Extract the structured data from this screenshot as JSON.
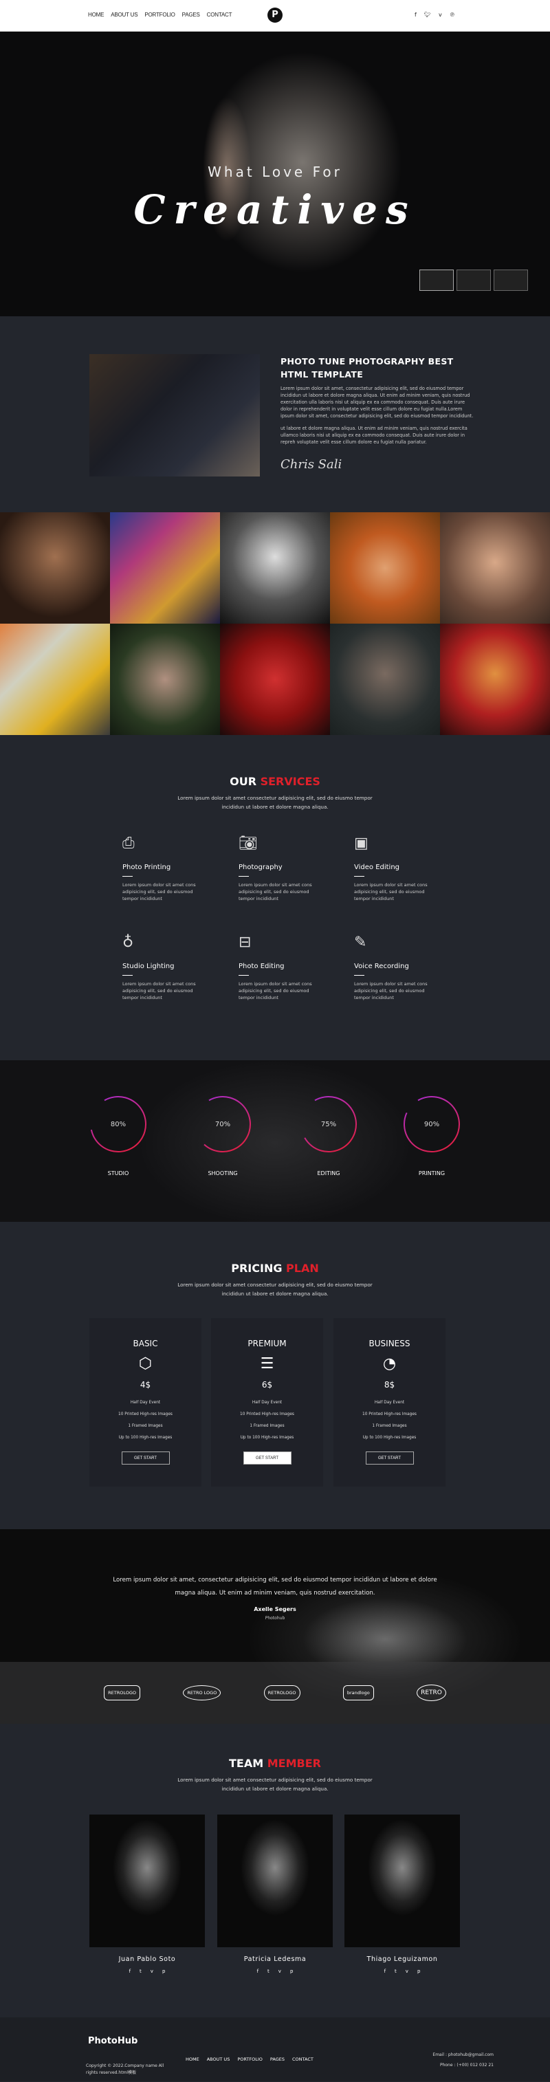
{
  "header": {
    "nav": [
      "HOME",
      "ABOUT US",
      "PORTFOLIO",
      "PAGES",
      "CONTACT"
    ],
    "logo": "P",
    "social": [
      "f",
      "t",
      "v",
      "p"
    ]
  },
  "hero": {
    "subtitle": "What Love For",
    "title": "Creatives"
  },
  "about": {
    "title": "PHOTO TUNE PHOTOGRAPHY BEST HTML TEMPLATE",
    "p1": "Lorem ipsum dolor sit amet, consectetur adipisicing elit, sed do eiusmod tempor incididun ut labore et dolore magna aliqua. Ut enim ad minim veniam, quis nostrud exercitation ulla laboris nisi ut aliquip ex ea commodo consequat. Duis aute irure dolor in reprehenderit in voluptate velit esse cillum dolore eu fugiat nulla.Lorem ipsum dolor sit amet, consectetur adipisicing elit, sed do eiusmod tempor incididunt.",
    "p2": "ut labore et dolore magna aliqua. Ut enim ad minim veniam, quis nostrud exercita ullamco laboris nisi ut aliquip ex ea commodo consequat. Duis aute irure dolor in repreh voluptate velit esse cillum dolore eu fugiat nulla pariatur.",
    "signature": "Chris Sali"
  },
  "services": {
    "title_white": "OUR",
    "title_red": "SERVICES",
    "subtitle": "Lorem ipsum dolor sit amet consectetur adipisicing elit, sed do eiusmo tempor incididun ut labore et dolore magna aliqua.",
    "items": [
      {
        "icon": "printer-icon",
        "glyph": "⎙",
        "title": "Photo Printing",
        "text": "Lorem ipsum dolor sit amet cons adipisicing elit, sed do eiusmod tempor incididunt"
      },
      {
        "icon": "camera-icon",
        "glyph": "📷︎",
        "title": "Photography",
        "text": "Lorem ipsum dolor sit amet cons adipisicing elit, sed do eiusmod tempor incididunt"
      },
      {
        "icon": "video-icon",
        "glyph": "▣",
        "title": "Video Editing",
        "text": "Lorem ipsum dolor sit amet cons adipisicing elit, sed do eiusmod tempor incididunt"
      },
      {
        "icon": "lightbulb-icon",
        "glyph": "♁",
        "title": "Studio Lighting",
        "text": "Lorem ipsum dolor sit amet cons adipisicing elit, sed do eiusmod tempor incididunt"
      },
      {
        "icon": "paintbrush-icon",
        "glyph": "⊟",
        "title": "Photo Editing",
        "text": "Lorem ipsum dolor sit amet cons adipisicing elit, sed do eiusmod tempor incididunt"
      },
      {
        "icon": "pencil-ruler-icon",
        "glyph": "✎",
        "title": "Voice Recording",
        "text": "Lorem ipsum dolor sit amet cons adipisicing elit, sed do eiusmod tempor incididunt"
      }
    ]
  },
  "skills": [
    {
      "label": "STUDIO",
      "percent": 80
    },
    {
      "label": "SHOOTING",
      "percent": 70
    },
    {
      "label": "EDITING",
      "percent": 75
    },
    {
      "label": "PRINTING",
      "percent": 90
    }
  ],
  "colors": {
    "accent": "#e0202a",
    "ring_start": "#e0204a",
    "ring_end": "#b02cc0",
    "bg": "#23262d"
  },
  "pricing": {
    "title_white": "PRICING",
    "title_red": "PLAN",
    "subtitle": "Lorem ipsum dolor sit amet consectetur adipisicing elit, sed do eiusmo tempor incididun ut labore et dolore magna aliqua.",
    "plans": [
      {
        "name": "BASIC",
        "icon": "box-icon",
        "glyph": "⬡",
        "price": "4$",
        "features": [
          "Half Day Event",
          "10 Printed High-res Images",
          "1 Framed Images",
          "Up to 100 High-res Images"
        ],
        "button": "GET START"
      },
      {
        "name": "PREMIUM",
        "icon": "database-icon",
        "glyph": "☰",
        "price": "6$",
        "features": [
          "Half Day Event",
          "10 Printed High-res Images",
          "1 Framed Images",
          "Up to 100 High-res Images"
        ],
        "button": "GET START"
      },
      {
        "name": "BUSINESS",
        "icon": "pie-chart-icon",
        "glyph": "◔",
        "price": "8$",
        "features": [
          "Half Day Event",
          "10 Printed High-res Images",
          "1 Framed Images",
          "Up to 100 High-res Images"
        ],
        "button": "GET START"
      }
    ]
  },
  "testimonial": {
    "quote": "Lorem ipsum dolor sit amet, consectetur adipisicing elit, sed do eiusmod tempor incididun ut labore et dolore magna aliqua. Ut enim ad minim veniam, quis nostrud exercitation.",
    "name": "Axelle Segers",
    "role": "Photohub",
    "brands": [
      "RETROLOGO",
      "RETRO LOGO",
      "RETROLOGO",
      "brandlogo",
      "RETRO"
    ]
  },
  "team": {
    "title_white": "TEAM",
    "title_red": "MEMBER",
    "subtitle": "Lorem ipsum dolor sit amet consectetur adipisicing elit, sed do eiusmo tempor incididun ut labore et dolore magna aliqua.",
    "members": [
      {
        "name": "Juan Pablo Soto"
      },
      {
        "name": "Patricia Ledesma"
      },
      {
        "name": "Thiago Leguizamon"
      }
    ]
  },
  "footer": {
    "brand": "PhotoHub",
    "copyright": "Copyright © 2022.Company name All rights reserved.html模板",
    "nav": [
      "HOME",
      "ABOUT US",
      "PORTFOLIO",
      "PAGES",
      "CONTACT"
    ],
    "email": "Email :  photohub@gmail.com",
    "phone": "Phone :  (+00) 012 032 21"
  }
}
